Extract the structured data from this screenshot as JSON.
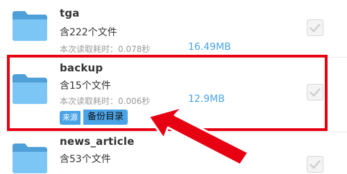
{
  "folders": [
    {
      "name": "tga",
      "count": "含222个文件",
      "read_time": "本次读取耗时：0.078秒",
      "size": "16.49MB"
    },
    {
      "name": "backup",
      "count": "含15个文件",
      "read_time": "本次读取耗时：0.006秒",
      "size": "12.9MB",
      "tag_source": "来源",
      "tag_dir": "备份目录"
    },
    {
      "name": "news_article",
      "count": "含53个文件"
    }
  ],
  "colors": {
    "accent": "#4aa3e6",
    "highlight": "#e60012",
    "folder": "#6ec0f3"
  },
  "icons": [
    "folder-icon",
    "checkbox-icon",
    "red-arrow-annotation"
  ]
}
